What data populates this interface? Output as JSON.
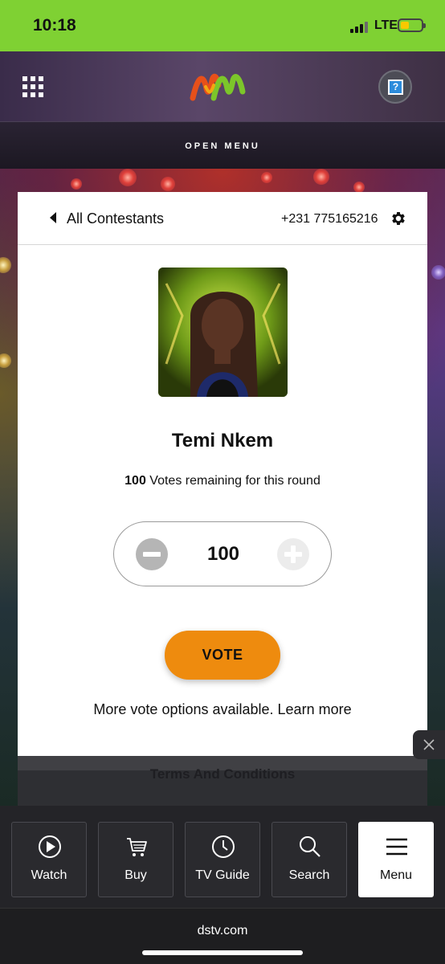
{
  "status_bar": {
    "time": "10:18",
    "network": "LTE",
    "battery_level": 0.3,
    "signal_bars": 3
  },
  "header": {
    "menu_icon": "grid-icon",
    "logo_icon": "mm-logo",
    "help_icon": "help-icon"
  },
  "open_menu": {
    "label": "OPEN MENU"
  },
  "card": {
    "back_label": "All Contestants",
    "phone": "+231 775165216",
    "settings_icon": "gear-icon",
    "contestant_name": "Temi Nkem",
    "votes_remaining_count": "100",
    "votes_remaining_text": " Votes remaining for this round",
    "vote_value": "100",
    "vote_button": "VOTE",
    "more_options": "More vote options available. Learn more"
  },
  "terms": {
    "label": "Terms And Conditions"
  },
  "bottom_nav": {
    "items": [
      {
        "label": "Watch",
        "icon": "play-icon"
      },
      {
        "label": "Buy",
        "icon": "cart-icon"
      },
      {
        "label": "TV Guide",
        "icon": "clock-icon"
      },
      {
        "label": "Search",
        "icon": "search-icon"
      },
      {
        "label": "Menu",
        "icon": "hamburger-icon",
        "active": true
      }
    ]
  },
  "browser": {
    "url": "dstv.com"
  },
  "colors": {
    "status_bar": "#7fd133",
    "vote_button": "#ee8b0e",
    "active_nav": "#ffffff"
  }
}
